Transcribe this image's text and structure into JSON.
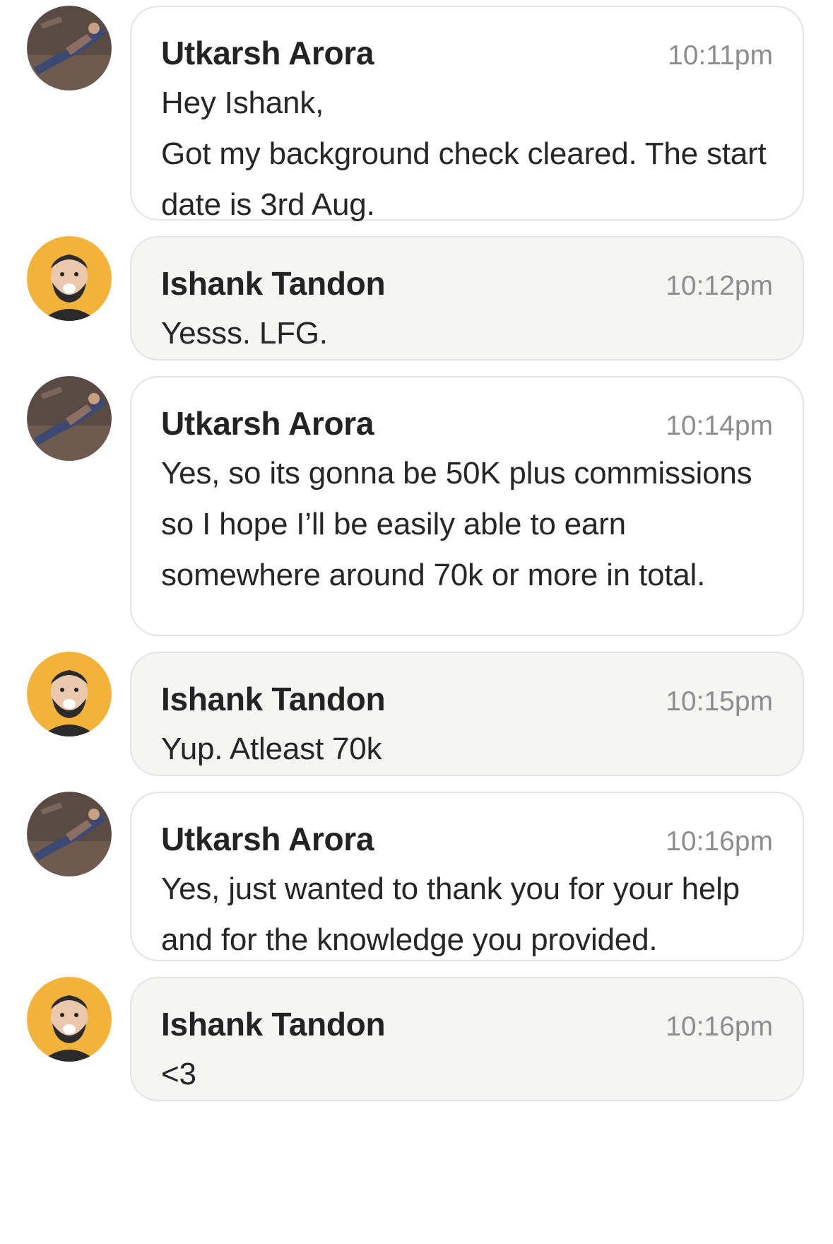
{
  "colors": {
    "page_background": "#ffffff",
    "bubble_light": "#ffffff",
    "bubble_grey": "#f5f5f4",
    "bubble_border": "#e3e3e3",
    "name_text": "#232323",
    "timestamp_text": "#8d8d8d",
    "avatar_ishank_bg": "#f3b23a"
  },
  "avatars": {
    "utkarsh": {
      "icon": "photo-avatar-icon"
    },
    "ishank": {
      "icon": "smiling-face-avatar-icon"
    }
  },
  "messages": [
    {
      "sender": "Utkarsh Arora",
      "time": "10:11pm",
      "text": "Hey Ishank,\nGot my background check cleared. The start date is 3rd Aug."
    },
    {
      "sender": "Ishank Tandon",
      "time": "10:12pm",
      "text": "Yesss. LFG."
    },
    {
      "sender": "Utkarsh Arora",
      "time": "10:14pm",
      "text": "Yes, so its gonna be 50K plus commissions so I hope I’ll be easily able to earn somewhere around 70k or more in total."
    },
    {
      "sender": "Ishank Tandon",
      "time": "10:15pm",
      "text": "Yup. Atleast 70k"
    },
    {
      "sender": "Utkarsh Arora",
      "time": "10:16pm",
      "text": "Yes, just wanted to thank you for your help and for the knowledge you provided."
    },
    {
      "sender": "Ishank Tandon",
      "time": "10:16pm",
      "text": "<3"
    }
  ]
}
